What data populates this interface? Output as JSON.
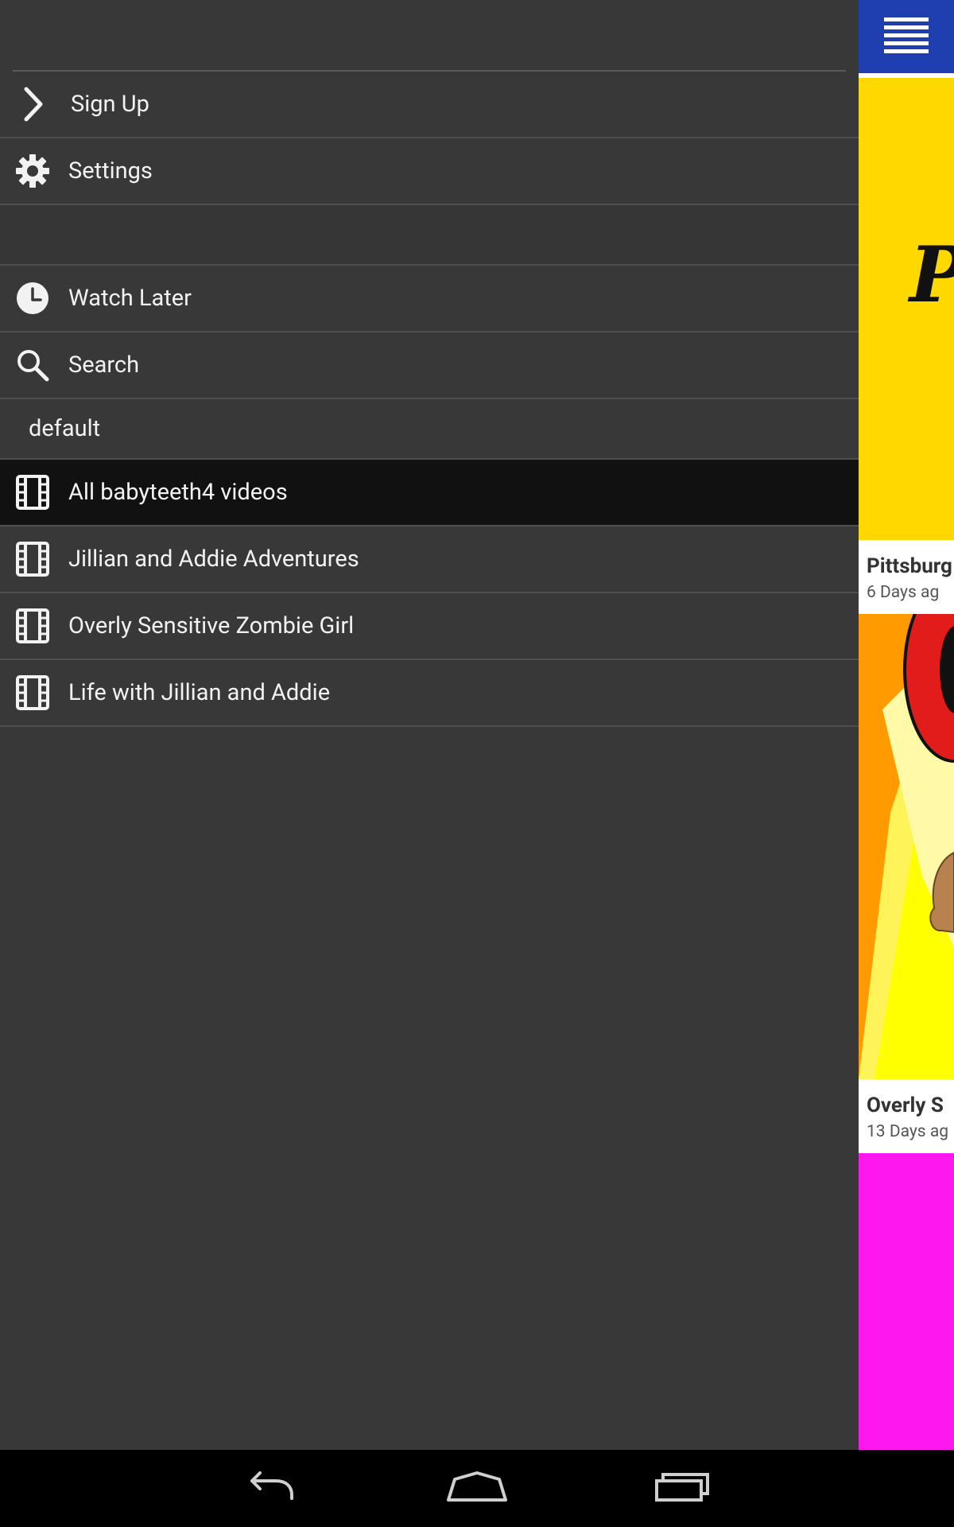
{
  "drawer": {
    "items": [
      {
        "label": "Sign Up",
        "icon": "chevron-right-icon"
      },
      {
        "label": "Settings",
        "icon": "gear-icon"
      },
      {
        "label": "Watch Later",
        "icon": "clock-icon"
      },
      {
        "label": "Search",
        "icon": "search-icon"
      }
    ],
    "section_label": "default",
    "playlists": [
      {
        "label": "All babyteeth4 videos",
        "icon": "film-icon",
        "selected": true
      },
      {
        "label": "Jillian and Addie Adventures",
        "icon": "film-icon",
        "selected": false
      },
      {
        "label": "Overly Sensitive Zombie Girl",
        "icon": "film-icon",
        "selected": false
      },
      {
        "label": "Life with Jillian and Addie",
        "icon": "film-icon",
        "selected": false
      }
    ]
  },
  "content": {
    "menu_icon": "hamburger-menu-icon",
    "videos": [
      {
        "title": "Pittsburg",
        "age": "6 Days ag",
        "thumbnail_text": "P",
        "thumbnail_color": "#ffd800"
      },
      {
        "title": "Overly S",
        "age": "13 Days ag",
        "thumbnail_color": "#ff9a00"
      },
      {
        "thumbnail_color": "#ff17f0"
      }
    ]
  },
  "colors": {
    "drawer_background": "#383838",
    "selected_row": "#121112",
    "app_bar": "#1f3fb0",
    "nav_bar": "#000000"
  },
  "system_nav": {
    "buttons": [
      "back-icon",
      "home-icon",
      "recent-apps-icon"
    ]
  }
}
